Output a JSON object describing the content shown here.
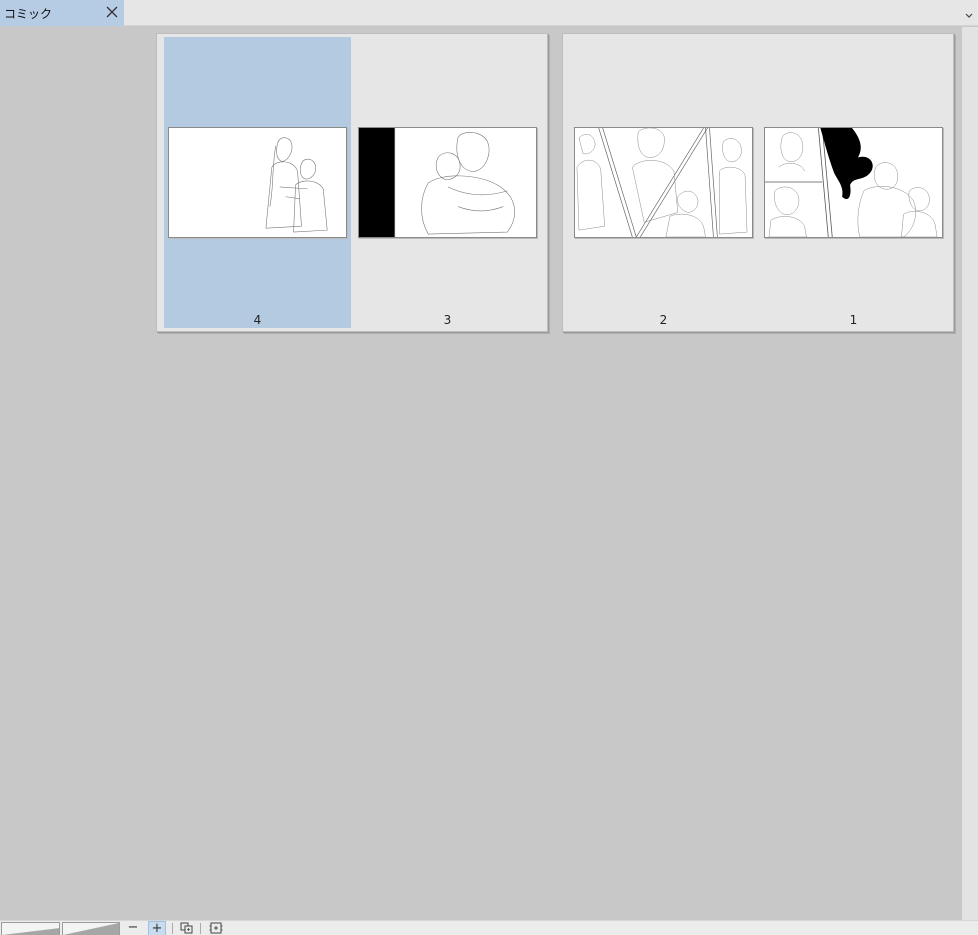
{
  "tab": {
    "title": "コミック"
  },
  "spreads": [
    {
      "pages": [
        {
          "number": "4",
          "selected": true
        },
        {
          "number": "3",
          "selected": false
        }
      ]
    },
    {
      "pages": [
        {
          "number": "2",
          "selected": false
        },
        {
          "number": "1",
          "selected": false
        }
      ]
    }
  ],
  "toolbar": {
    "zoom_out_label": "−",
    "zoom_in_label": "+",
    "zoom_out_icon": "minus-icon",
    "zoom_in_icon": "plus-icon",
    "copy_icon": "duplicate-pages-icon",
    "settings_icon": "page-settings-icon"
  },
  "colors": {
    "selection": "#b4cae0",
    "workspace": "#c8c8c8",
    "tab_active": "#b5cce4"
  }
}
